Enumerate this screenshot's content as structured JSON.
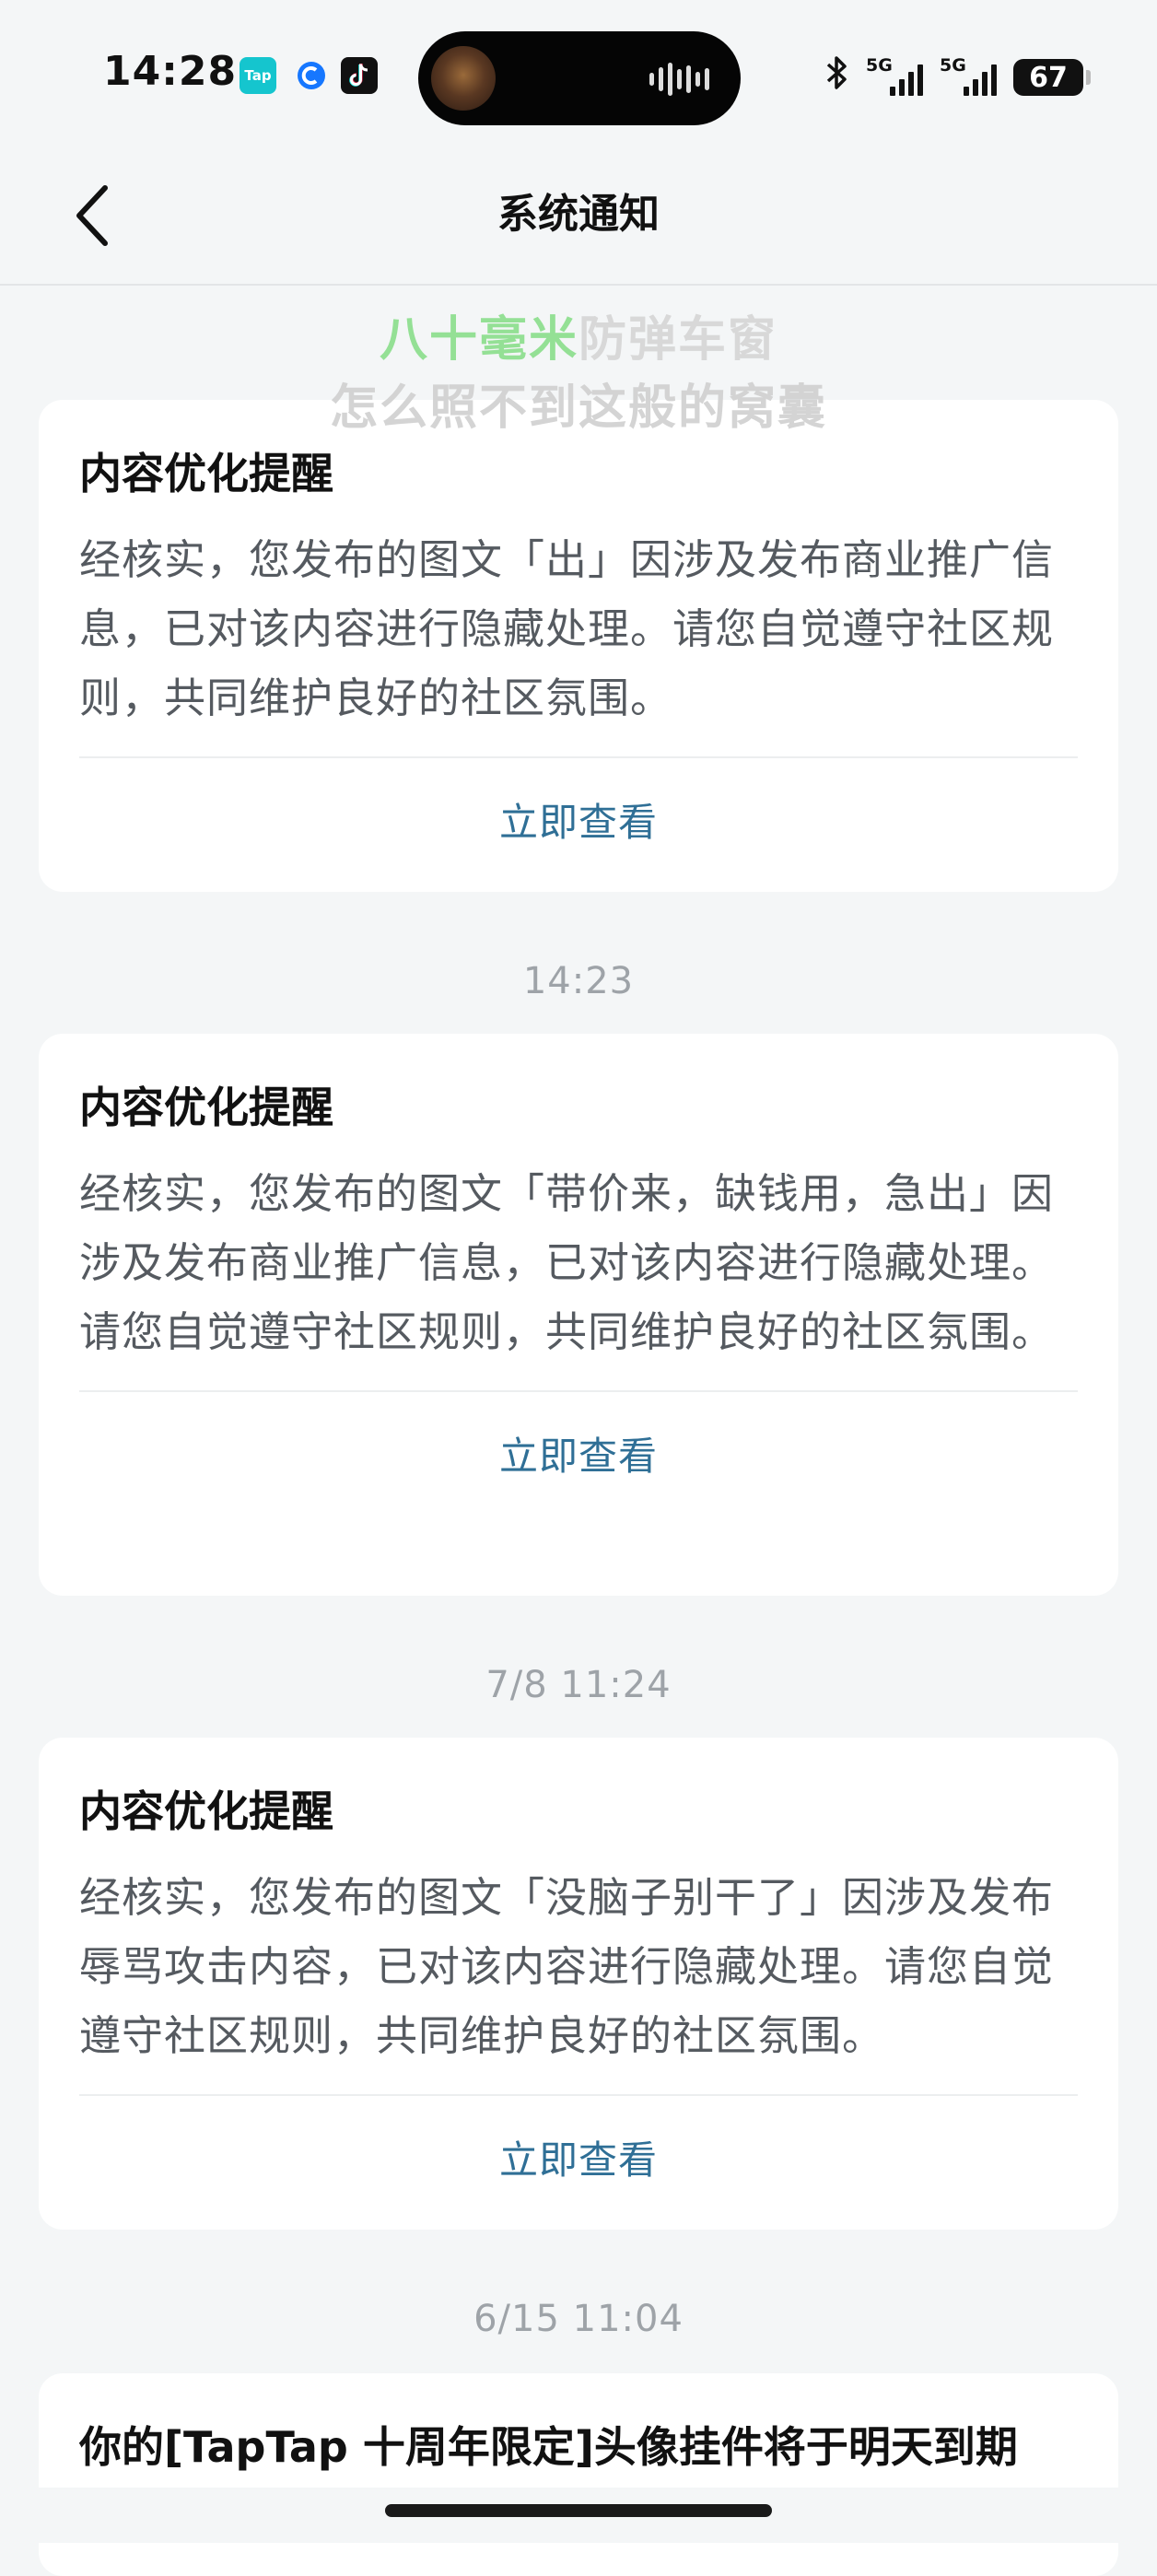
{
  "status_bar": {
    "time": "14:28",
    "apps": [
      "Tap",
      "circle-app-icon",
      "tiktok-icon"
    ],
    "network_1": "5G",
    "network_2": "5G",
    "battery": "67"
  },
  "nav": {
    "title": "系统通知"
  },
  "lyrics": {
    "line1_highlight": "八十毫米",
    "line1_rest": "防弹车窗",
    "line2": "怎么照不到这般的窝囊"
  },
  "notifications": [
    {
      "title": "内容优化提醒",
      "body": "经核实，您发布的图文「出」因涉及发布商业推广信息，已对该内容进行隐藏处理。请您自觉遵守社区规则，共同维护良好的社区氛围。",
      "action": "立即查看"
    },
    {
      "timestamp": "14:23",
      "title": "内容优化提醒",
      "body": "经核实，您发布的图文「带价来，缺钱用，急出」因涉及发布商业推广信息，已对该内容进行隐藏处理。请您自觉遵守社区规则，共同维护良好的社区氛围。",
      "action": "立即查看"
    },
    {
      "timestamp": "7/8  11:24",
      "title": "内容优化提醒",
      "body": "经核实，您发布的图文「没脑子别干了」因涉及发布辱骂攻击内容，已对该内容进行隐藏处理。请您自觉遵守社区规则，共同维护良好的社区氛围。",
      "action": "立即查看"
    },
    {
      "timestamp": "6/15  11:04",
      "title": "你的[TapTap 十周年限定]头像挂件将于明天到期"
    }
  ],
  "colors": {
    "background": "#f4f6f7",
    "card": "#ffffff",
    "action_link": "#2f6f96",
    "body_text": "#555a60",
    "timestamp": "#9ea3a8",
    "lyric_highlight": "#8ade8a"
  }
}
